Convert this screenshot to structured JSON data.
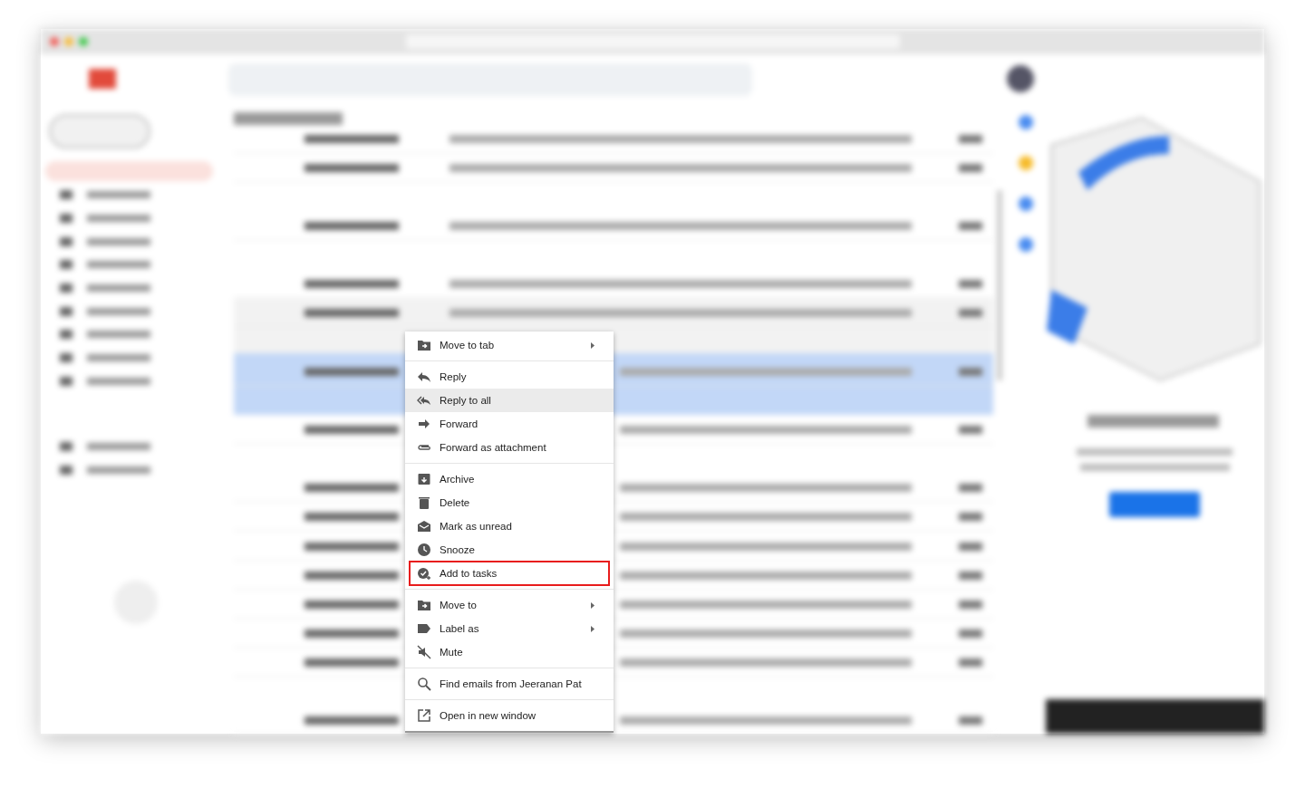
{
  "context_menu": {
    "groups": [
      [
        {
          "label": "Move to tab",
          "submenu": true,
          "highlighted": false,
          "outlined": false
        }
      ],
      [
        {
          "label": "Reply",
          "submenu": false,
          "highlighted": false,
          "outlined": false
        },
        {
          "label": "Reply to all",
          "submenu": false,
          "highlighted": true,
          "outlined": false
        },
        {
          "label": "Forward",
          "submenu": false,
          "highlighted": false,
          "outlined": false
        },
        {
          "label": "Forward as attachment",
          "submenu": false,
          "highlighted": false,
          "outlined": false
        }
      ],
      [
        {
          "label": "Archive",
          "submenu": false,
          "highlighted": false,
          "outlined": false
        },
        {
          "label": "Delete",
          "submenu": false,
          "highlighted": false,
          "outlined": false
        },
        {
          "label": "Mark as unread",
          "submenu": false,
          "highlighted": false,
          "outlined": false
        },
        {
          "label": "Snooze",
          "submenu": false,
          "highlighted": false,
          "outlined": false
        },
        {
          "label": "Add to tasks",
          "submenu": false,
          "highlighted": false,
          "outlined": true
        }
      ],
      [
        {
          "label": "Move to",
          "submenu": true,
          "highlighted": false,
          "outlined": false
        },
        {
          "label": "Label as",
          "submenu": true,
          "highlighted": false,
          "outlined": false
        },
        {
          "label": "Mute",
          "submenu": false,
          "highlighted": false,
          "outlined": false
        }
      ],
      [
        {
          "label": "Find emails from Jeeranan Pat",
          "submenu": false,
          "highlighted": false,
          "outlined": false
        }
      ],
      [
        {
          "label": "Open in new window",
          "submenu": false,
          "highlighted": false,
          "outlined": false
        }
      ]
    ]
  }
}
